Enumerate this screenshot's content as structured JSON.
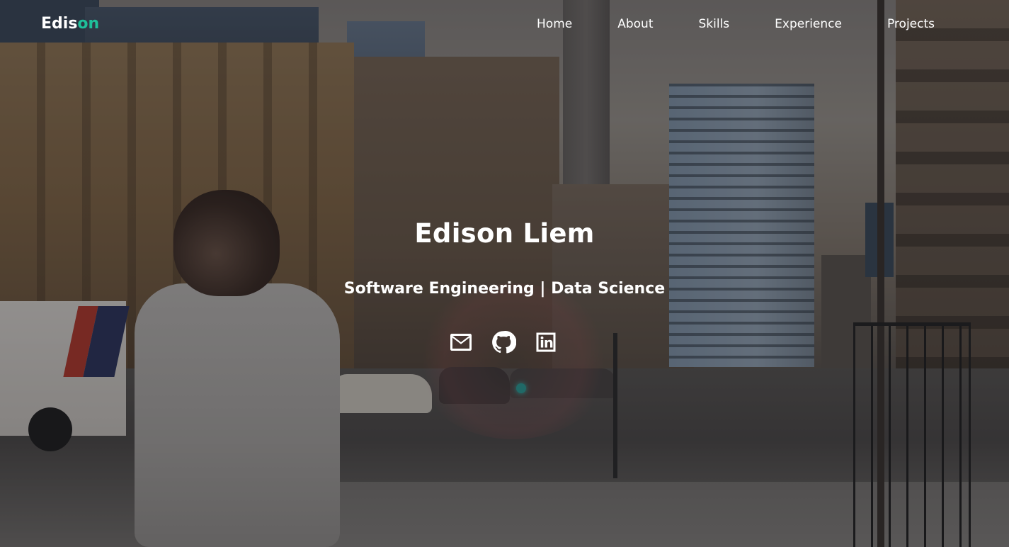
{
  "nav": {
    "logo_part1": "Edis",
    "logo_part2": "on",
    "links": [
      {
        "label": "Home"
      },
      {
        "label": "About"
      },
      {
        "label": "Skills"
      },
      {
        "label": "Experience"
      },
      {
        "label": "Projects"
      }
    ]
  },
  "hero": {
    "name": "Edison Liem",
    "tagline": "Software Engineering | Data Science",
    "social_icons": [
      "mail-icon",
      "github-icon",
      "linkedin-icon"
    ]
  },
  "colors": {
    "accent": "#1fc09a",
    "text": "#ffffff"
  }
}
